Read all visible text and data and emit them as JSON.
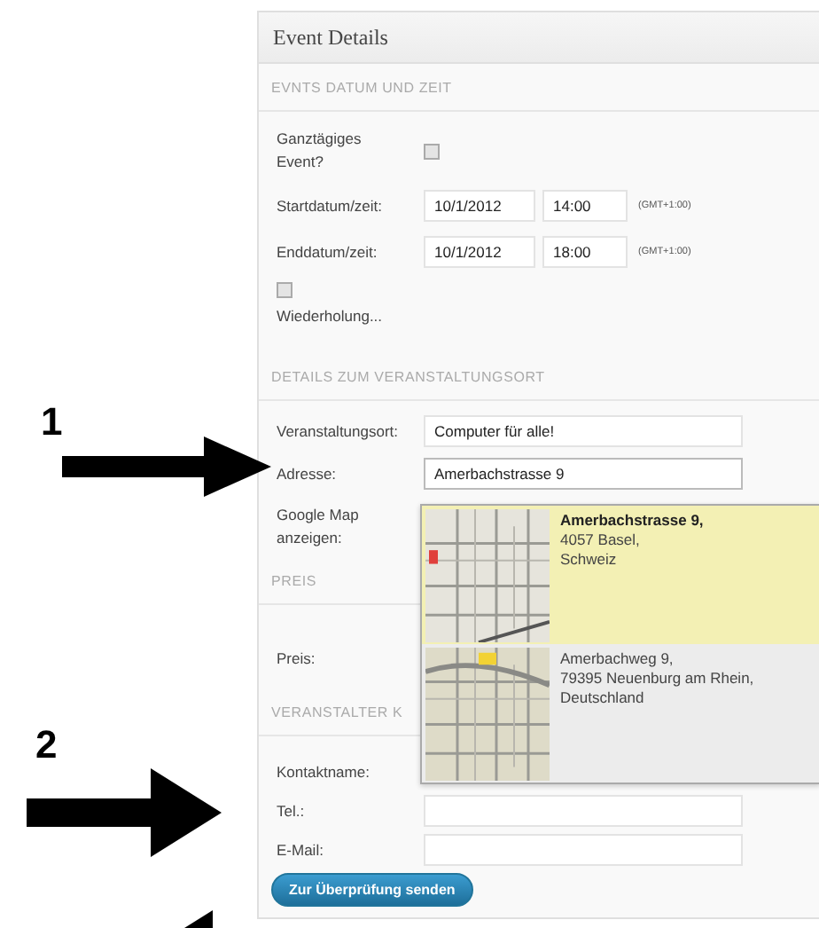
{
  "annotations": [
    {
      "number": "1"
    },
    {
      "number": "2"
    }
  ],
  "panel": {
    "title": "Event Details",
    "sections": [
      {
        "heading": "EVNTS DATUM UND ZEIT",
        "rows": [
          {
            "kind": "checkbox",
            "label": "Ganztägiges Event?",
            "checked": false
          },
          {
            "kind": "datetime",
            "label": "Startdatum/zeit:",
            "date": "10/1/2012",
            "time": "14:00",
            "zone": "(GMT+1:00)"
          },
          {
            "kind": "datetime",
            "label": "Enddatum/zeit:",
            "date": "10/1/2012",
            "time": "18:00",
            "zone": "(GMT+1:00)"
          },
          {
            "kind": "stacked_checkbox",
            "label": "Wiederholung...",
            "checked": false
          }
        ]
      },
      {
        "heading": "DETAILS ZUM VERANSTALTUNGSORT",
        "rows": [
          {
            "kind": "text",
            "label": "Veranstaltungsort:",
            "value": "Computer für alle!"
          },
          {
            "kind": "text",
            "label": "Adresse:",
            "value": "Amerbachstrasse 9",
            "focused": true
          },
          {
            "kind": "label",
            "label": "Google Map anzeigen:"
          }
        ]
      },
      {
        "heading": "PREIS",
        "rows": [
          {
            "kind": "label",
            "label": "Preis:"
          }
        ]
      },
      {
        "heading": "VERANSTALTER K",
        "rows": [
          {
            "kind": "label",
            "label": "Kontaktname:"
          },
          {
            "kind": "text",
            "label": "Tel.:"
          },
          {
            "kind": "text",
            "label": "E-Mail:"
          }
        ]
      }
    ],
    "submit": "Zur Überprüfung senden"
  },
  "suggestions": [
    {
      "selected": true,
      "line_1": "Amerbachstrasse 9,",
      "line_2": "4057 Basel,",
      "line_3": "Schweiz"
    },
    {
      "selected": false,
      "line_1": "Amerbachweg 9,",
      "line_2": "79395 Neuenburg am Rhein,",
      "line_3": "Deutschland"
    }
  ]
}
